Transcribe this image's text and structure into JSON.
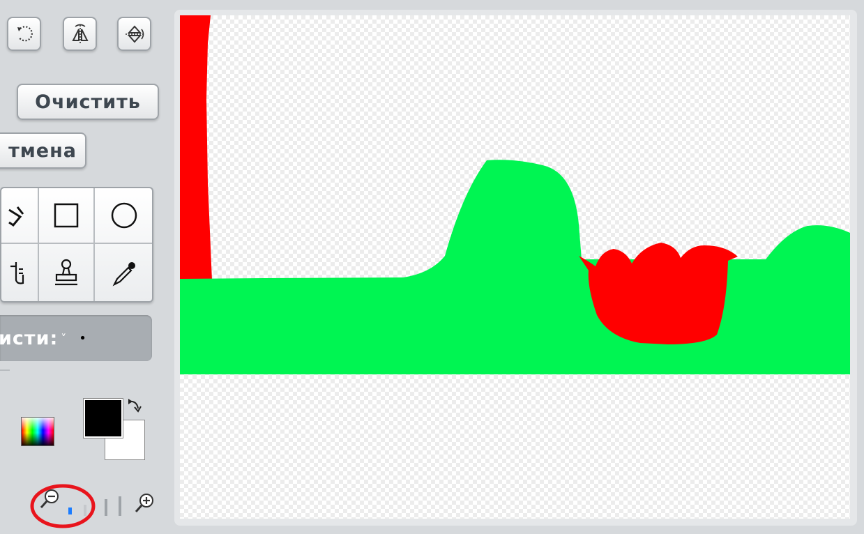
{
  "toolbar": {
    "rotate_icon": "rotate-ccw-icon",
    "flip_h_icon": "flip-horizontal-icon",
    "flip_v_icon": "flip-vertical-icon",
    "clear_label": "Очистить",
    "undo_label": "тмена"
  },
  "tools": [
    "fill-icon",
    "rectangle-icon",
    "ellipse-icon",
    "select-icon",
    "stamp-icon",
    "eyedropper-icon"
  ],
  "brush": {
    "label": "исти:",
    "chevron": "˅",
    "dot": "•"
  },
  "colors": {
    "primary": "#000000",
    "secondary": "#ffffff",
    "swap_icon": "swap-arrow-icon",
    "palette_icon": "color-palette-icon"
  },
  "zoom": {
    "out_icon": "zoom-out-icon",
    "in_icon": "zoom-in-icon",
    "level": 1,
    "levels": 4,
    "active_color": "#1a7cff"
  },
  "drawing": {
    "ground_color": "#00f552",
    "object_color": "#ff0000",
    "annotation_color": "#e8141c"
  }
}
